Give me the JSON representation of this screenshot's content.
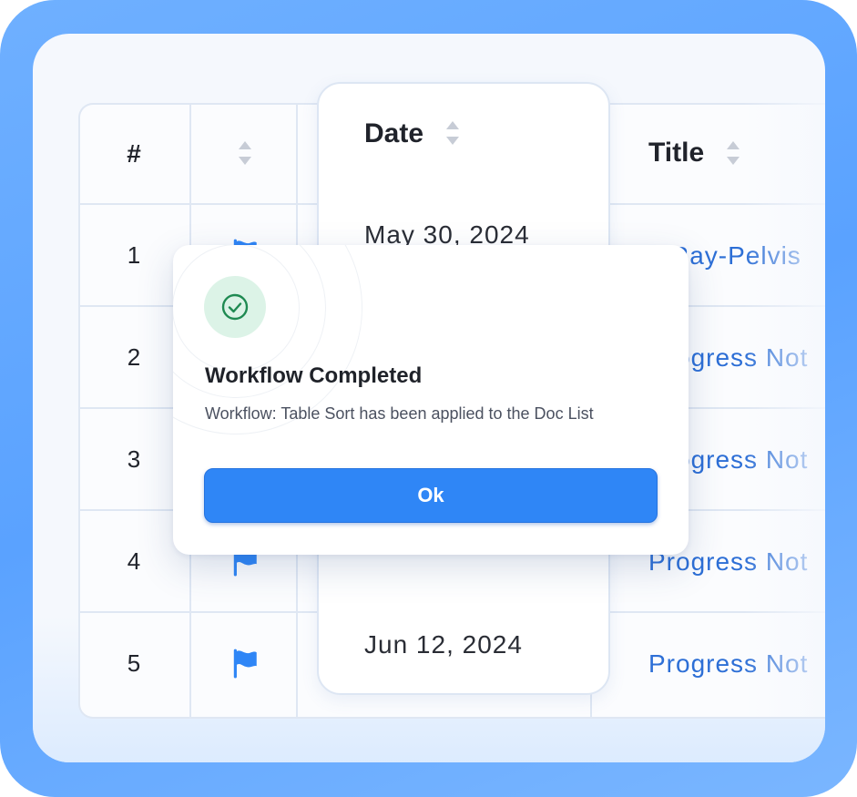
{
  "table": {
    "headers": {
      "number": "#",
      "date": "Date",
      "title": "Title"
    },
    "rows": [
      {
        "number": "1",
        "date": "May 30, 2024",
        "title": "Ray-Pelvis",
        "flagged": true
      },
      {
        "number": "2",
        "date": "",
        "title": "Progress Not",
        "flagged": false
      },
      {
        "number": "3",
        "date": "",
        "title": "Progress Not",
        "flagged": false
      },
      {
        "number": "4",
        "date": "",
        "title": "Progress Not",
        "flagged": true
      },
      {
        "number": "5",
        "date": "Jun 12, 2024",
        "title": "Progress Not",
        "flagged": true
      }
    ],
    "icons": {
      "sort": "sort-icon",
      "flag": "flag-icon"
    }
  },
  "modal": {
    "icon": "check-circle-icon",
    "title": "Workflow Completed",
    "message": "Workflow: Table Sort has been applied to the Doc List",
    "ok_label": "Ok"
  },
  "colors": {
    "frame": "#5aa2ff",
    "accent": "#2f86f6",
    "link": "#2d6fd6",
    "success": "#1f8a52",
    "success_bg": "#dcf3e7"
  }
}
